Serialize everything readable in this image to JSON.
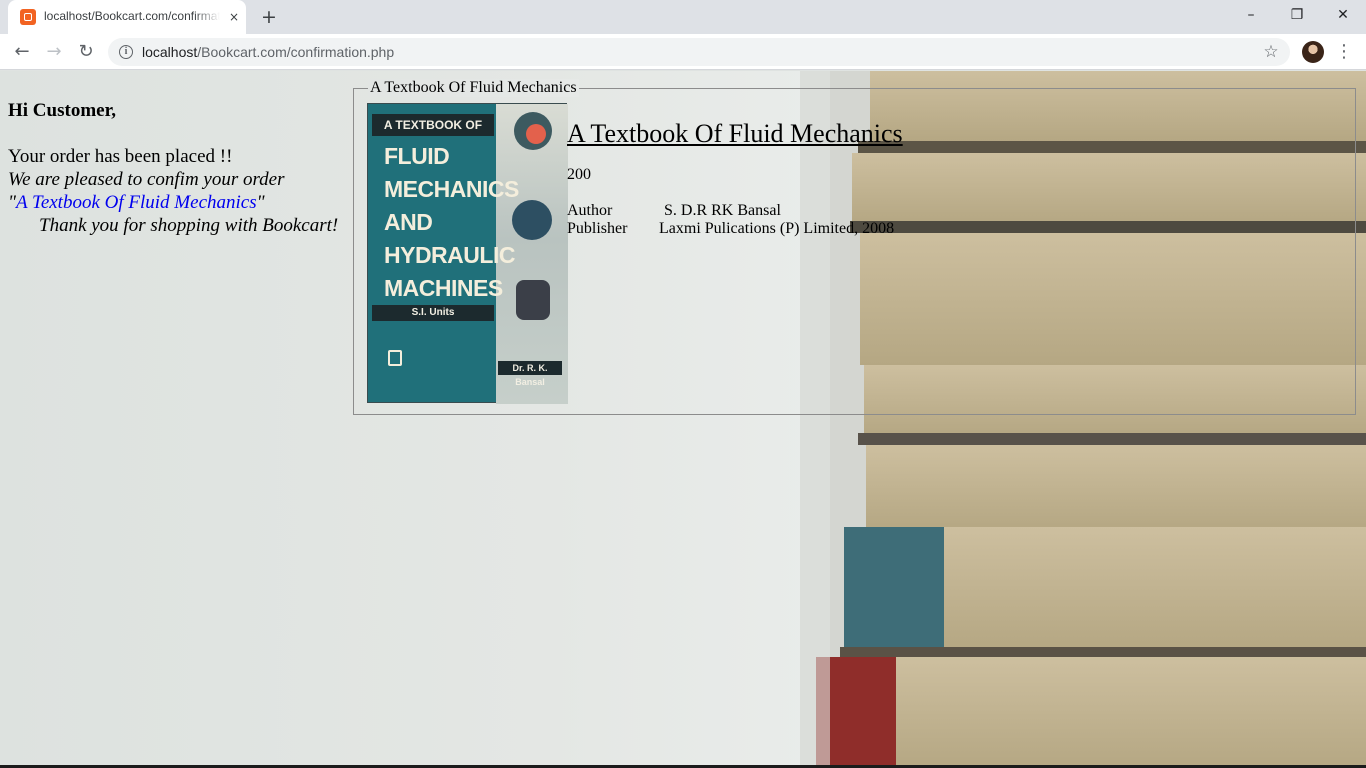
{
  "browser": {
    "tab_title": "localhost/Bookcart.com/confirmation.php",
    "tab_close_icon": "×",
    "new_tab_icon": "+",
    "url_host": "localhost",
    "url_path": "/Bookcart.com/confirmation.php",
    "window_buttons": {
      "minimize": "–",
      "maximize": "❐",
      "close": "✕"
    },
    "nav": {
      "back": "←",
      "forward": "→",
      "reload": "↻"
    },
    "star_icon": "☆",
    "menu_icon": "⋮",
    "info_icon": "i"
  },
  "message": {
    "greeting": "Hi Customer,",
    "placed": "Your order has been placed !!",
    "pleased": "We are pleased to confim your order",
    "quote_open": "\"",
    "book_link": "A Textbook Of Fluid Mechanics",
    "quote_close": "\"",
    "thanks": "Thank you for shopping with Bookcart!"
  },
  "book": {
    "legend": "A Textbook Of Fluid Mechanics",
    "title": "A Textbook Of Fluid Mechanics",
    "price": "200",
    "author_label": "Author",
    "author": "S. D.R RK Bansal",
    "publisher_label": "Publisher",
    "publisher": "Laxmi Pulications (P) Limited, 2008",
    "cover": {
      "band": "A TEXTBOOK OF",
      "line1": "FLUID",
      "line2": "MECHANICS",
      "line3": "AND",
      "line4": "HYDRAULIC",
      "line5": "MACHINES",
      "units": "S.I. Units",
      "author": "Dr. R. K. Bansal"
    }
  }
}
